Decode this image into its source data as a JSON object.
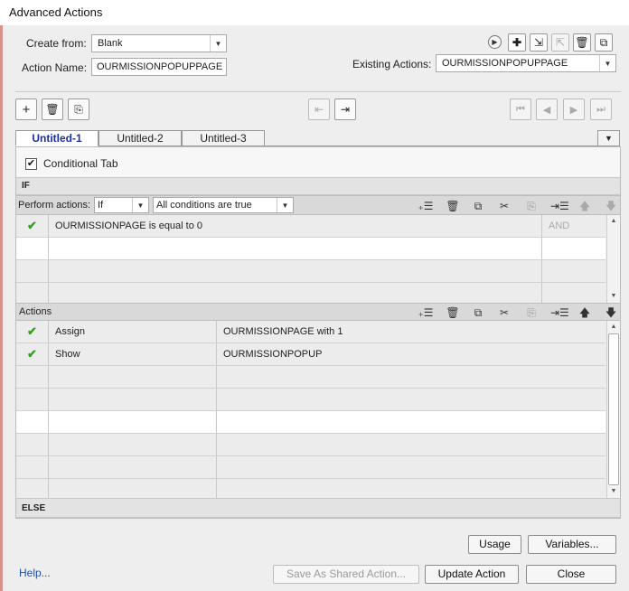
{
  "window": {
    "title": "Advanced Actions"
  },
  "header": {
    "create_from_label": "Create from:",
    "create_from_value": "Blank",
    "action_name_label": "Action Name:",
    "action_name_value": "OURMISSIONPOPUPPAGE",
    "existing_actions_label": "Existing Actions:",
    "existing_actions_value": "OURMISSIONPOPUPPAGE"
  },
  "tabs": [
    {
      "label": "Untitled-1",
      "active": true
    },
    {
      "label": "Untitled-2",
      "active": false
    },
    {
      "label": "Untitled-3",
      "active": false
    }
  ],
  "conditional_tab": {
    "label": "Conditional Tab",
    "checked": true,
    "mark": "✔"
  },
  "if_section": {
    "header": "IF",
    "perform_label": "Perform actions:",
    "perform_value": "If",
    "condition_mode": "All conditions are true",
    "rows": [
      {
        "check": "✔",
        "text": "OURMISSIONPAGE   is equal to   0",
        "op": "AND"
      }
    ]
  },
  "actions_section": {
    "header": "Actions",
    "rows": [
      {
        "check": "✔",
        "action": "Assign",
        "target": "OURMISSIONPAGE    with    1"
      },
      {
        "check": "✔",
        "action": "Show",
        "target": "OURMISSIONPOPUP"
      }
    ]
  },
  "else_section": {
    "header": "ELSE"
  },
  "buttons": {
    "usage": "Usage",
    "variables": "Variables...",
    "save_shared": "Save As Shared Action...",
    "update": "Update Action",
    "close": "Close"
  },
  "help": "Help..."
}
